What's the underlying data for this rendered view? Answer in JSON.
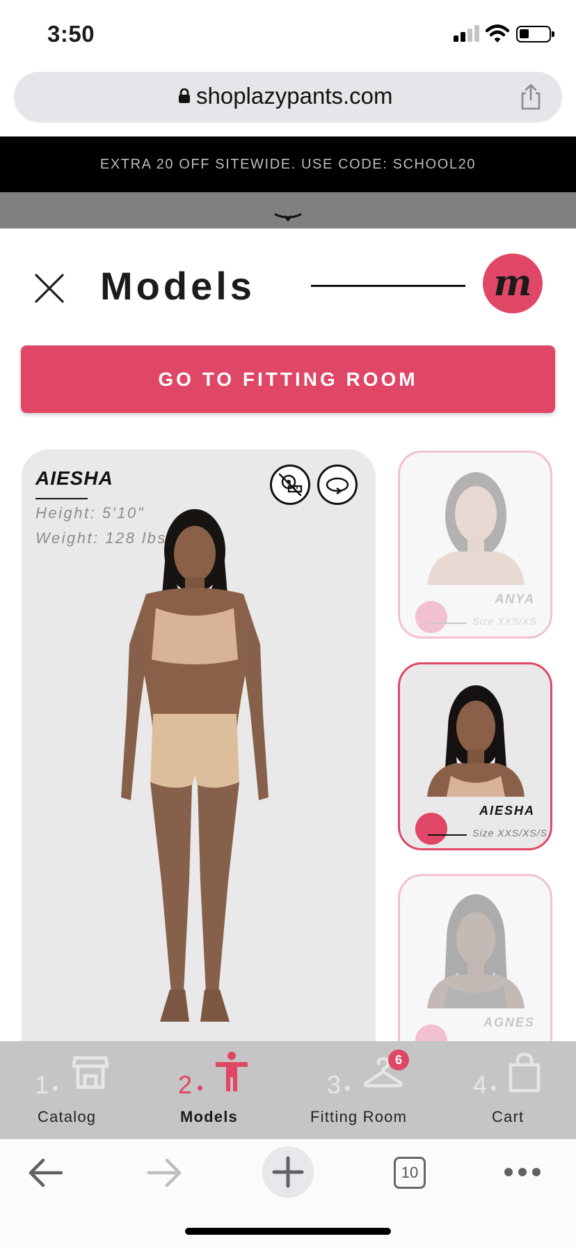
{
  "status_bar": {
    "time": "3:50"
  },
  "browser": {
    "url": "shoplazypants.com",
    "tab_count": "10"
  },
  "promo": {
    "text": "EXTRA 20 OFF SITEWIDE. USE CODE: SCHOOL20"
  },
  "header": {
    "title": "Models",
    "logo_letter": "m"
  },
  "cta": {
    "label": "GO TO FITTING ROOM"
  },
  "selected_model": {
    "name": "AIESHA",
    "height": "Height: 5'10\"",
    "weight": "Weight: 128 lbs"
  },
  "models": [
    {
      "name": "ANYA",
      "size": "Size XXS/XS",
      "selected": false
    },
    {
      "name": "AIESHA",
      "size": "Size XXS/XS/S",
      "selected": true
    },
    {
      "name": "AGNES",
      "size": "",
      "selected": false
    }
  ],
  "steps": [
    {
      "number": "1",
      "label": "Catalog",
      "icon": "storefront-icon"
    },
    {
      "number": "2",
      "label": "Models",
      "icon": "person-icon"
    },
    {
      "number": "3",
      "label": "Fitting Room",
      "icon": "hanger-icon",
      "badge": "6"
    },
    {
      "number": "4",
      "label": "Cart",
      "icon": "shopping-bag-icon"
    }
  ],
  "colors": {
    "accent": "#e04665",
    "accent_light": "#f2c1cf",
    "promo_bg": "#000000",
    "step_nav_bg": "#c5c5c5"
  }
}
